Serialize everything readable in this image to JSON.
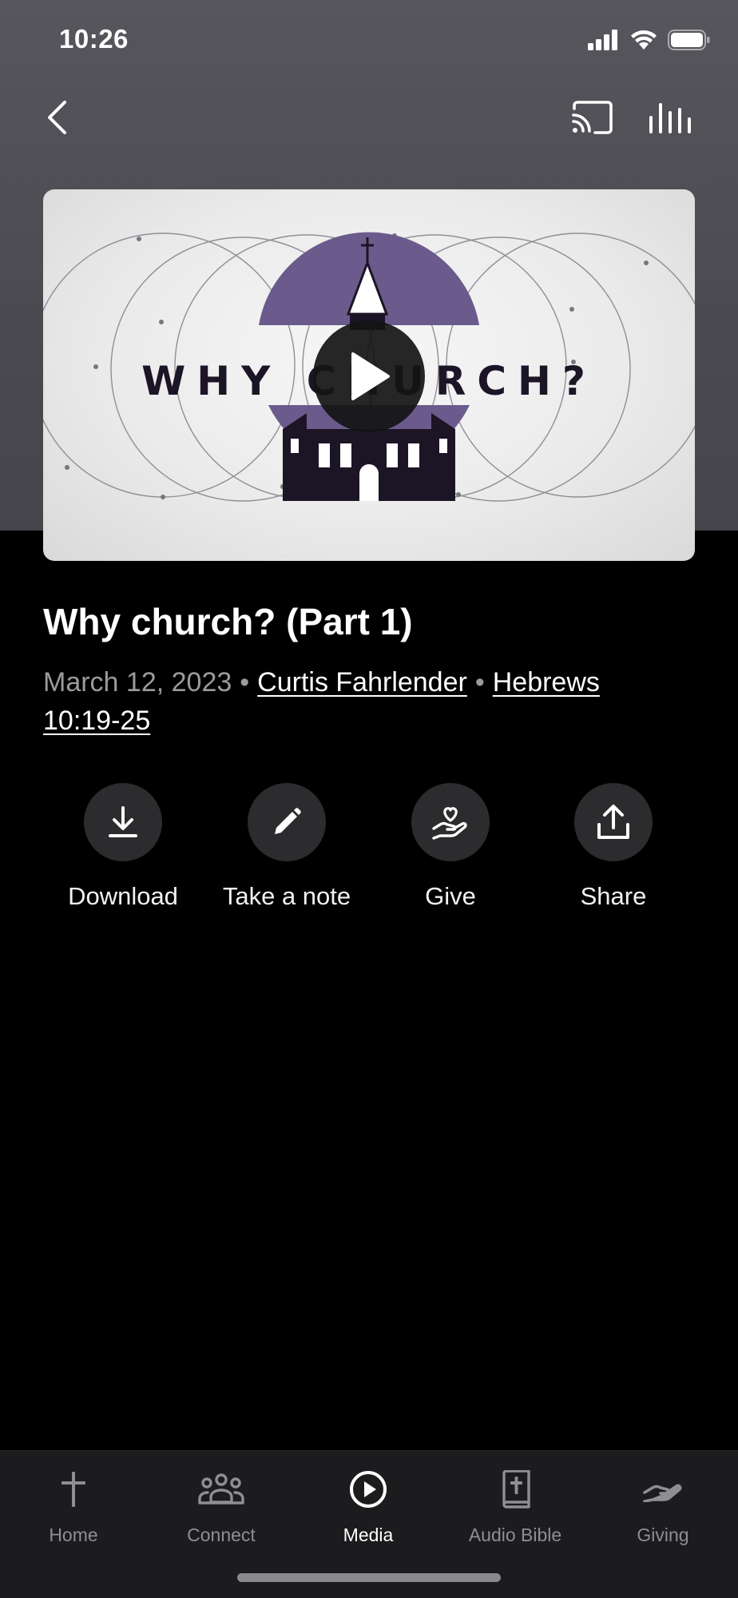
{
  "status_bar": {
    "time": "10:26"
  },
  "video": {
    "artwork_title": "WHY CHURCH?"
  },
  "episode": {
    "title": "Why church? (Part 1)",
    "date": "March 12, 2023",
    "speaker": "Curtis Fahrlender",
    "scripture": "Hebrews 10:19-25"
  },
  "actions": [
    {
      "label": "Download",
      "icon": "download-icon"
    },
    {
      "label": "Take a note",
      "icon": "pencil-icon"
    },
    {
      "label": "Give",
      "icon": "heart-hand-icon"
    },
    {
      "label": "Share",
      "icon": "share-icon"
    }
  ],
  "tabs": [
    {
      "label": "Home",
      "icon": "cross-icon",
      "active": false
    },
    {
      "label": "Connect",
      "icon": "people-icon",
      "active": false
    },
    {
      "label": "Media",
      "icon": "play-circle-icon",
      "active": true
    },
    {
      "label": "Audio Bible",
      "icon": "bible-icon",
      "active": false
    },
    {
      "label": "Giving",
      "icon": "giving-hand-icon",
      "active": false
    }
  ],
  "colors": {
    "header_bg": "#4b4a50",
    "accent_purple": "#6b5b8c",
    "action_circle": "#2c2c2e",
    "tab_bar": "#1c1c1e",
    "muted_text": "#9b9b9b"
  }
}
